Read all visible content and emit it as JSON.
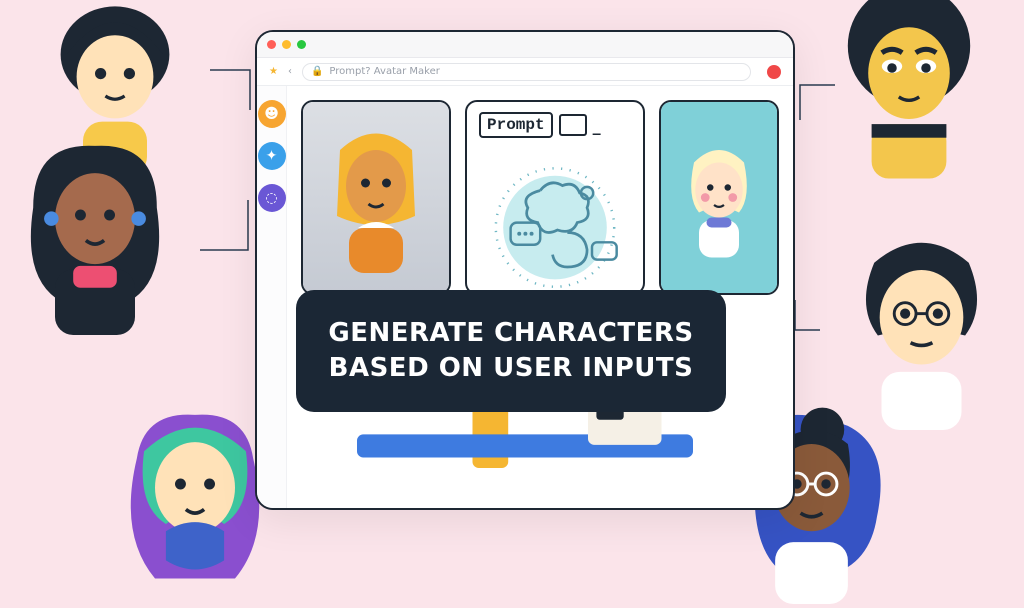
{
  "headline": {
    "line1": "Generate characters",
    "line2": "based on user inputs"
  },
  "app": {
    "address_text": "Prompt? Avatar Maker",
    "sidebar": {
      "items": [
        {
          "name": "profile-icon",
          "glyph": "☻",
          "bg": "#f7a531"
        },
        {
          "name": "bird-icon",
          "glyph": "✦",
          "bg": "#3aa0ea"
        },
        {
          "name": "settings-icon",
          "glyph": "◌",
          "bg": "#6a57d5"
        }
      ]
    },
    "prompt_label": "Prompt"
  },
  "avatars": {
    "tl": {
      "hair": "#1d2733",
      "skin": "#ffe2b8",
      "shirt": "#f7c94a"
    },
    "tr": {
      "hair": "#1d2733",
      "skin": "#f3c64c",
      "shirt": "#f3c64c"
    },
    "ml": {
      "hair": "#1d2733",
      "skin": "#a56a4d",
      "shirt": "#ed4f72"
    },
    "mr": {
      "hair": "#1d2733",
      "skin": "#ffe2b8",
      "shirt": "#ffffff"
    },
    "bl": {
      "hair": "#3ec7a0",
      "skin": "#ffe2b8",
      "shirt": "#8a4fcf"
    },
    "br": {
      "hair": "#1d2733",
      "skin": "#8a5a3a",
      "shirt": "#ffffff"
    },
    "cardA": {
      "hair": "#f5b632",
      "skin": "#e39a4a",
      "shirt": "#e88a2b"
    },
    "cardC": {
      "hair": "#fff2c2",
      "skin": "#ffe2c8",
      "shirt": "#ffffff"
    }
  }
}
